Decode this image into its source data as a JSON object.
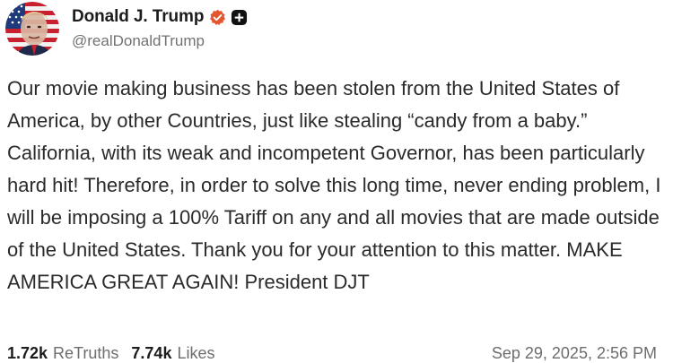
{
  "author": {
    "display_name": "Donald J. Trump",
    "handle": "@realDonaldTrump",
    "avatar_icon": "flag-portrait-avatar",
    "verified_icon": "verified-badge-icon",
    "verified_color": "#e4572e",
    "platform_icon": "truth-plus-icon"
  },
  "post": {
    "text": "Our movie making business has been stolen from the United States of America, by other Countries, just like stealing “candy from a baby.” California, with its weak and incompetent Governor, has been particularly hard hit! Therefore, in order to solve this long time, never ending problem, I will be imposing a 100% Tariff on any and all movies that are made outside of the United States. Thank you for your attention to this matter. MAKE AMERICA GREAT AGAIN! President DJT"
  },
  "footer": {
    "retruths_count": "1.72k",
    "retruths_label": "ReTruths",
    "likes_count": "7.74k",
    "likes_label": "Likes",
    "timestamp": "Sep 29, 2025, 2:56 PM"
  }
}
